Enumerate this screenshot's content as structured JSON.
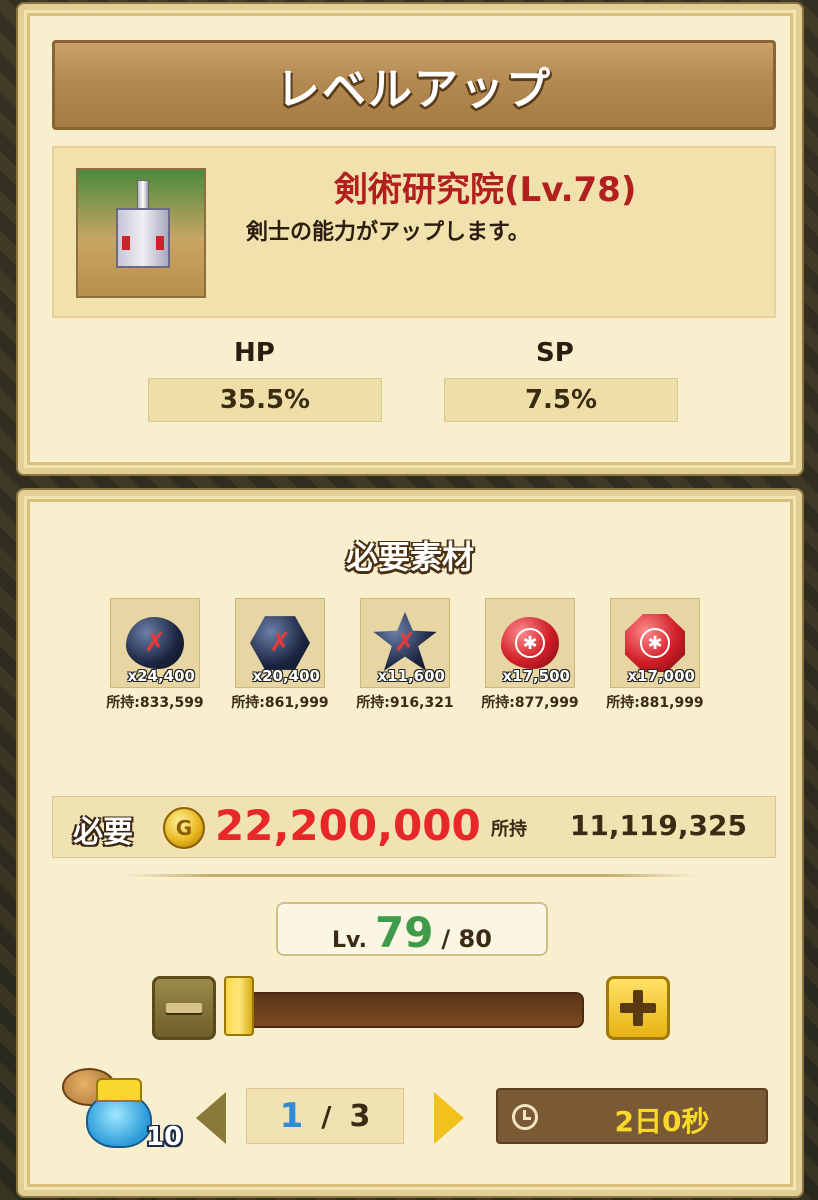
{
  "levelup": {
    "title": "レベルアップ",
    "building_name": "剣術研究院(Lv.78)",
    "description": "剣士の能力がアップします。",
    "stats": [
      {
        "label": "HP",
        "value": "35.5%"
      },
      {
        "label": "SP",
        "value": "7.5%"
      }
    ]
  },
  "materials": {
    "title": "必要素材",
    "items": [
      {
        "icon": "dark-blob-sword-gem-icon",
        "count": "x24,400",
        "owned": "所持:833,599"
      },
      {
        "icon": "dark-hex-sword-gem-icon",
        "count": "x20,400",
        "owned": "所持:861,999"
      },
      {
        "icon": "dark-star-sword-gem-icon",
        "count": "x11,600",
        "owned": "所持:916,321"
      },
      {
        "icon": "red-blob-crest-gem-icon",
        "count": "x17,500",
        "owned": "所持:877,999"
      },
      {
        "icon": "red-oct-crest-gem-icon",
        "count": "x17,000",
        "owned": "所持:881,999"
      }
    ]
  },
  "cost": {
    "label": "必要",
    "coin_symbol": "G",
    "value": "22,200,000",
    "owned_label": "所持",
    "owned_value": "11,119,325"
  },
  "level": {
    "prefix": "Lv.",
    "value": "79",
    "max": "/ 80",
    "slider_fraction": 0.0
  },
  "builder": {
    "count": "10"
  },
  "pager": {
    "current": "1",
    "separator": "/",
    "total": "3"
  },
  "timer": {
    "text": "2日0秒"
  },
  "colors": {
    "building_name": "#b21f1f",
    "cost_value": "#e82828",
    "level_value": "#3f9a4a",
    "page_current": "#2f8ad8",
    "timer_text": "#f8d82a"
  }
}
